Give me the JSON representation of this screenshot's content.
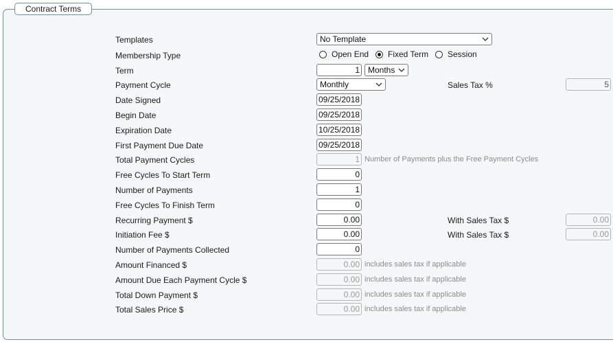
{
  "legend": "Contract Terms",
  "templates": {
    "label": "Templates",
    "value": "No Template"
  },
  "membership_type": {
    "label": "Membership Type",
    "options": [
      "Open End",
      "Fixed Term",
      "Session"
    ],
    "selected": "Fixed Term"
  },
  "term": {
    "label": "Term",
    "value": "1",
    "unit": "Months"
  },
  "payment_cycle": {
    "label": "Payment Cycle",
    "value": "Monthly"
  },
  "sales_tax_pct": {
    "label": "Sales Tax %",
    "value": "5"
  },
  "date_signed": {
    "label": "Date Signed",
    "value": "09/25/2018"
  },
  "begin_date": {
    "label": "Begin Date",
    "value": "09/25/2018"
  },
  "expiration_date": {
    "label": "Expiration Date",
    "value": "10/25/2018"
  },
  "first_payment_due": {
    "label": "First Payment Due Date",
    "value": "09/25/2018"
  },
  "total_payment_cycles": {
    "label": "Total Payment Cycles",
    "value": "1",
    "note": "Number of Payments plus the Free Payment Cycles"
  },
  "free_cycles_start": {
    "label": "Free Cycles To Start Term",
    "value": "0"
  },
  "number_of_payments": {
    "label": "Number of Payments",
    "value": "1"
  },
  "free_cycles_finish": {
    "label": "Free Cycles To Finish Term",
    "value": "0"
  },
  "recurring_payment": {
    "label": "Recurring Payment $",
    "value": "0.00",
    "with_tax_label": "With Sales Tax $",
    "with_tax_value": "0.00"
  },
  "initiation_fee": {
    "label": "Initiation Fee $",
    "value": "0.00",
    "with_tax_label": "With Sales Tax $",
    "with_tax_value": "0.00"
  },
  "payments_collected": {
    "label": "Number of Payments Collected",
    "value": "0"
  },
  "amount_financed": {
    "label": "Amount Financed $",
    "value": "0.00",
    "note": "includes sales tax if applicable"
  },
  "amount_due_each": {
    "label": "Amount Due Each Payment Cycle $",
    "value": "0.00",
    "note": "includes sales tax if applicable"
  },
  "total_down_payment": {
    "label": "Total Down Payment $",
    "value": "0.00",
    "note": "includes sales tax if applicable"
  },
  "total_sales_price": {
    "label": "Total Sales Price $",
    "value": "0.00",
    "note": "includes sales tax if applicable"
  },
  "colors": {
    "border": "#6a8fa8",
    "panel_bg": "#f6f7f8",
    "disabled_text": "#9a9a9a"
  }
}
